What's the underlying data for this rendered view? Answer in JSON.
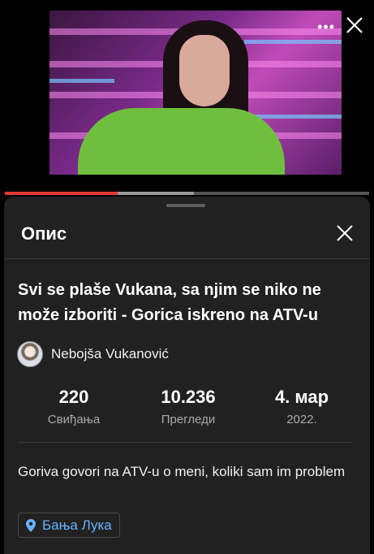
{
  "player": {
    "progress_played": 0.31,
    "progress_buffered": 0.52,
    "menu_icon": "more-dots-icon",
    "close_icon": "close-icon"
  },
  "sheet": {
    "title": "Опис",
    "close_icon": "close-icon"
  },
  "video": {
    "title": "Svi se plaše Vukana, sa njim se niko ne može izboriti - Gorica iskreno na ATV-u",
    "channel_name": "Nebojša Vukanović",
    "description": "Goriva govori na ATV-u o meni, koliki sam im problem",
    "location": "Бања Лука"
  },
  "stats": {
    "likes_value": "220",
    "likes_label": "Свиђања",
    "views_value": "10.236",
    "views_label": "Прегледи",
    "date_value": "4. мар",
    "date_label": "2022."
  },
  "colors": {
    "accent_red": "#e53935",
    "link_blue": "#6ab2ff",
    "sheet_bg": "#212121"
  }
}
